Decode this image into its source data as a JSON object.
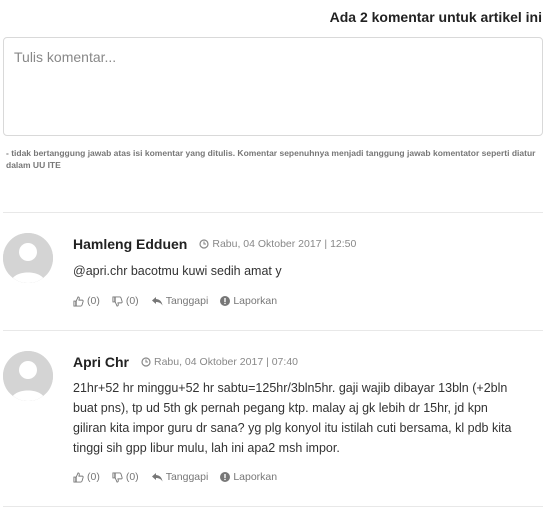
{
  "header": {
    "title": "Ada 2 komentar untuk artikel ini"
  },
  "form": {
    "placeholder": "Tulis komentar...",
    "disclaimer": "- tidak bertanggung jawab atas isi komentar yang ditulis. Komentar sepenuhnya menjadi tanggung jawab komentator seperti diatur dalam UU ITE"
  },
  "comments": [
    {
      "author": "Hamleng Edduen",
      "date": "Rabu, 04 Oktober 2017 | 12:50",
      "text": "@apri.chr bacotmu kuwi sedih amat y",
      "likes": "(0)",
      "dislikes": "(0)",
      "reply_label": "Tanggapi",
      "report_label": "Laporkan"
    },
    {
      "author": "Apri Chr",
      "date": "Rabu, 04 Oktober 2017 | 07:40",
      "text": "21hr+52 hr minggu+52 hr sabtu=125hr/3bln5hr. gaji wajib dibayar 13bln (+2bln buat pns), tp ud 5th gk pernah pegang ktp. malay aj gk lebih dr 15hr, jd kpn giliran kita impor guru dr sana? yg plg konyol itu istilah cuti bersama, kl pdb kita tinggi sih gpp libur mulu, lah ini apa2 msh impor.",
      "likes": "(0)",
      "dislikes": "(0)",
      "reply_label": "Tanggapi",
      "report_label": "Laporkan"
    }
  ],
  "icons": {
    "avatar": "default-user-avatar",
    "clock": "clock-icon",
    "like": "thumbs-up-icon",
    "dislike": "thumbs-down-icon",
    "reply": "reply-icon",
    "report": "exclamation-circle-icon"
  }
}
